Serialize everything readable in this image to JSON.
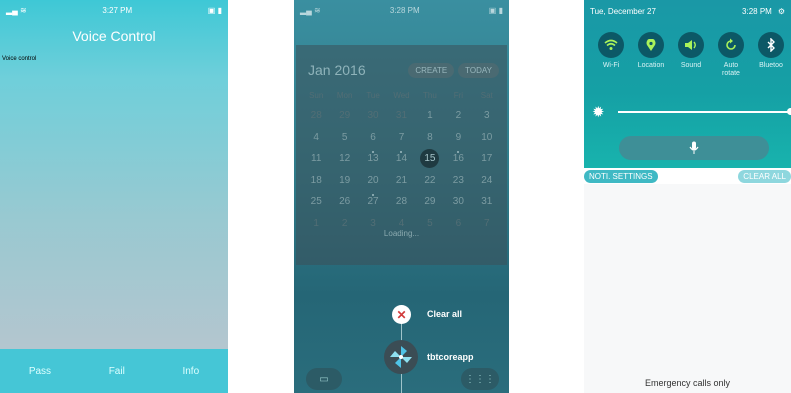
{
  "screen1": {
    "status": {
      "time": "3:27 PM"
    },
    "title": "Voice Control",
    "subtitle": "Voice control",
    "bottom_buttons": [
      "Pass",
      "Fail",
      "Info"
    ]
  },
  "screen2": {
    "status": {
      "time": "3:28 PM"
    },
    "calendar": {
      "month": "Jan 2016",
      "create_label": "CREATE",
      "today_label": "TODAY",
      "weekdays": [
        "Sun",
        "Mon",
        "Tue",
        "Wed",
        "Thu",
        "Fri",
        "Sat"
      ],
      "weeks": [
        [
          "28",
          "29",
          "30",
          "31",
          "1",
          "2",
          "3"
        ],
        [
          "4",
          "5",
          "6",
          "7",
          "8",
          "9",
          "10"
        ],
        [
          "11",
          "12",
          "13",
          "14",
          "15",
          "16",
          "17"
        ],
        [
          "18",
          "19",
          "20",
          "21",
          "22",
          "23",
          "24"
        ],
        [
          "25",
          "26",
          "27",
          "28",
          "29",
          "30",
          "31"
        ],
        [
          "1",
          "2",
          "3",
          "4",
          "5",
          "6",
          "7"
        ]
      ],
      "loading_text": "Loading..."
    },
    "recents": {
      "clear_all_label": "Clear all",
      "app_label": "tbtcoreapp"
    }
  },
  "screen3": {
    "status": {
      "date": "Tue, December 27",
      "time": "3:28 PM"
    },
    "toggles": [
      {
        "label": "Wi-Fi",
        "icon": "wifi-icon"
      },
      {
        "label": "Location",
        "icon": "location-icon"
      },
      {
        "label": "Sound",
        "icon": "sound-icon"
      },
      {
        "label": "Auto\nrotate",
        "icon": "rotate-icon"
      },
      {
        "label": "Bluetoo",
        "icon": "bluetooth-icon"
      }
    ],
    "noti_settings_label": "NOTI. SETTINGS",
    "clear_all_label": "CLEAR ALL",
    "emergency_text": "Emergency calls only"
  },
  "colors": {
    "screen1_top": "#3ec8d6",
    "screen1_bottom_bar": "#45c6d6",
    "screen2_bg": "#2f7b89",
    "screen3_panel": "#1a98a6",
    "toggle_active": "#aaf25a"
  }
}
